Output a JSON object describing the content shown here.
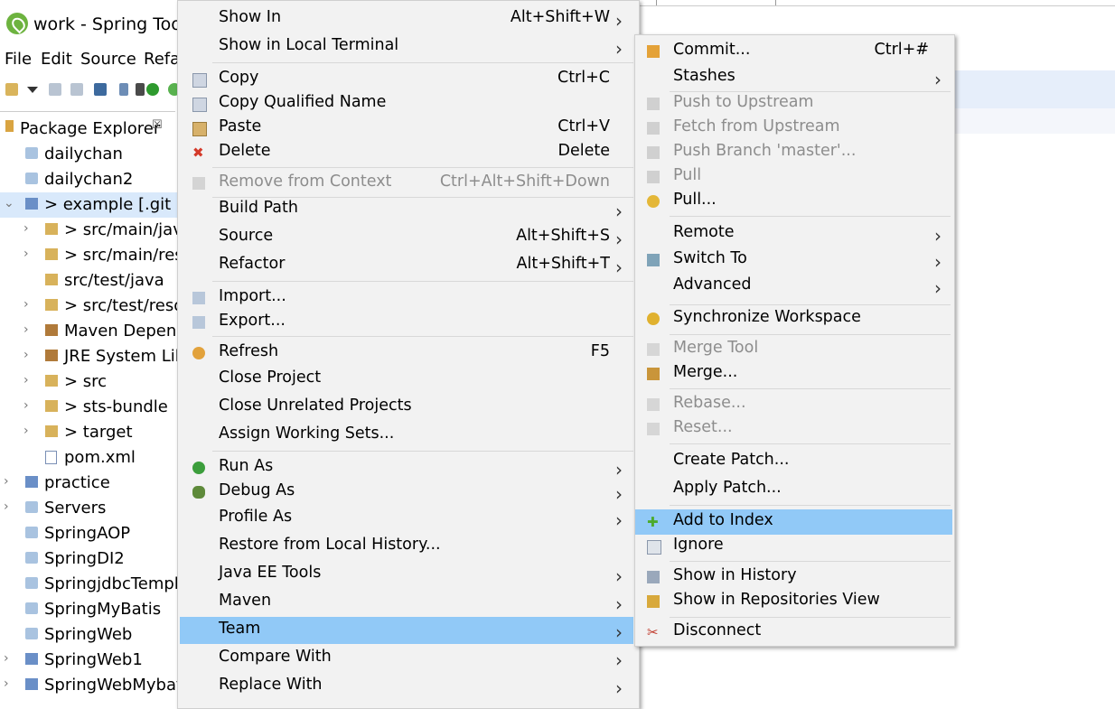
{
  "window": {
    "title": "work - Spring Tool"
  },
  "menubar": [
    "File",
    "Edit",
    "Source",
    "Refa"
  ],
  "explorer": {
    "tab_label": "Package Explorer",
    "close_glyph": "☒"
  },
  "tree": [
    {
      "label": "dailychan",
      "indent": 0,
      "twisty": "",
      "icon": "proj"
    },
    {
      "label": "dailychan2",
      "indent": 0,
      "twisty": "",
      "icon": "proj"
    },
    {
      "label": "> example [.git m",
      "indent": 0,
      "twisty": "v",
      "icon": "maven",
      "selected": true
    },
    {
      "label": "> src/main/java",
      "indent": 1,
      "twisty": ">",
      "icon": "pkg"
    },
    {
      "label": "> src/main/reso",
      "indent": 1,
      "twisty": ">",
      "icon": "pkg"
    },
    {
      "label": "src/test/java",
      "indent": 1,
      "twisty": "",
      "icon": "pkg"
    },
    {
      "label": "> src/test/reso",
      "indent": 1,
      "twisty": ">",
      "icon": "pkg"
    },
    {
      "label": "Maven Depend",
      "indent": 1,
      "twisty": ">",
      "icon": "lib"
    },
    {
      "label": "JRE System Libr",
      "indent": 1,
      "twisty": ">",
      "icon": "lib"
    },
    {
      "label": "> src",
      "indent": 1,
      "twisty": ">",
      "icon": "pkg"
    },
    {
      "label": "> sts-bundle",
      "indent": 1,
      "twisty": ">",
      "icon": "pkg"
    },
    {
      "label": "> target",
      "indent": 1,
      "twisty": ">",
      "icon": "pkg"
    },
    {
      "label": "pom.xml",
      "indent": 1,
      "twisty": "",
      "icon": "file"
    },
    {
      "label": "practice",
      "indent": 0,
      "twisty": ">",
      "icon": "maven"
    },
    {
      "label": "Servers",
      "indent": 0,
      "twisty": ">",
      "icon": "proj"
    },
    {
      "label": "SpringAOP",
      "indent": 0,
      "twisty": "",
      "icon": "proj"
    },
    {
      "label": "SpringDI2",
      "indent": 0,
      "twisty": "",
      "icon": "proj"
    },
    {
      "label": "SpringjdbcTempla",
      "indent": 0,
      "twisty": "",
      "icon": "proj"
    },
    {
      "label": "SpringMyBatis",
      "indent": 0,
      "twisty": "",
      "icon": "proj"
    },
    {
      "label": "SpringWeb",
      "indent": 0,
      "twisty": "",
      "icon": "proj"
    },
    {
      "label": "SpringWeb1",
      "indent": 0,
      "twisty": ">",
      "icon": "maven"
    },
    {
      "label": "SpringWebMybati",
      "indent": 0,
      "twisty": ">",
      "icon": "maven"
    }
  ],
  "context_menu": {
    "items": [
      {
        "label": "Show In",
        "accel": "Alt+Shift+W",
        "arrow": true
      },
      {
        "label": "Show in Local Terminal",
        "accel": "",
        "arrow": true
      },
      {
        "label": "Copy",
        "accel": "Ctrl+C",
        "icon": "copy-icon"
      },
      {
        "label": "Copy Qualified Name",
        "accel": "",
        "icon": "copy-qualified-icon"
      },
      {
        "label": "Paste",
        "accel": "Ctrl+V",
        "icon": "paste-icon"
      },
      {
        "label": "Delete",
        "accel": "Delete",
        "icon": "delete-icon"
      },
      {
        "label": "Remove from Context",
        "accel": "Ctrl+Alt+Shift+Down",
        "disabled": true,
        "icon": "remove-context-icon"
      },
      {
        "label": "Build Path",
        "accel": "",
        "arrow": true
      },
      {
        "label": "Source",
        "accel": "Alt+Shift+S",
        "arrow": true
      },
      {
        "label": "Refactor",
        "accel": "Alt+Shift+T",
        "arrow": true
      },
      {
        "label": "Import...",
        "accel": "",
        "icon": "import-icon"
      },
      {
        "label": "Export...",
        "accel": "",
        "icon": "export-icon"
      },
      {
        "label": "Refresh",
        "accel": "F5",
        "icon": "refresh-icon"
      },
      {
        "label": "Close Project",
        "accel": ""
      },
      {
        "label": "Close Unrelated Projects",
        "accel": ""
      },
      {
        "label": "Assign Working Sets...",
        "accel": ""
      },
      {
        "label": "Run As",
        "accel": "",
        "arrow": true,
        "icon": "run-icon"
      },
      {
        "label": "Debug As",
        "accel": "",
        "arrow": true,
        "icon": "debug-icon"
      },
      {
        "label": "Profile As",
        "accel": "",
        "arrow": true
      },
      {
        "label": "Restore from Local History...",
        "accel": ""
      },
      {
        "label": "Java EE Tools",
        "accel": "",
        "arrow": true
      },
      {
        "label": "Maven",
        "accel": "",
        "arrow": true
      },
      {
        "label": "Team",
        "accel": "",
        "arrow": true,
        "highlighted": true
      },
      {
        "label": "Compare With",
        "accel": "",
        "arrow": true
      },
      {
        "label": "Replace With",
        "accel": "",
        "arrow": true
      }
    ]
  },
  "team_menu": {
    "items": [
      {
        "label": "Commit...",
        "accel": "Ctrl+#",
        "icon": "commit-icon"
      },
      {
        "label": "Stashes",
        "accel": "",
        "arrow": true
      },
      {
        "label": "Push to Upstream",
        "disabled": true,
        "icon": "push-icon"
      },
      {
        "label": "Fetch from Upstream",
        "disabled": true,
        "icon": "fetch-icon"
      },
      {
        "label": "Push Branch 'master'...",
        "disabled": true,
        "icon": "push-branch-icon"
      },
      {
        "label": "Pull",
        "disabled": true,
        "icon": "pull-icon"
      },
      {
        "label": "Pull...",
        "icon": "pull-dialog-icon"
      },
      {
        "label": "Remote",
        "arrow": true
      },
      {
        "label": "Switch To",
        "arrow": true,
        "icon": "switch-branch-icon"
      },
      {
        "label": "Advanced",
        "arrow": true
      },
      {
        "label": "Synchronize Workspace",
        "icon": "synchronize-icon"
      },
      {
        "label": "Merge Tool",
        "disabled": true,
        "icon": "merge-tool-icon"
      },
      {
        "label": "Merge...",
        "icon": "merge-icon"
      },
      {
        "label": "Rebase...",
        "disabled": true,
        "icon": "rebase-icon"
      },
      {
        "label": "Reset...",
        "disabled": true,
        "icon": "reset-icon"
      },
      {
        "label": "Create Patch..."
      },
      {
        "label": "Apply Patch..."
      },
      {
        "label": "Add to Index",
        "highlighted": true,
        "icon": "add-icon"
      },
      {
        "label": "Ignore",
        "icon": "ignore-icon"
      },
      {
        "label": "Show in History",
        "icon": "history-icon"
      },
      {
        "label": "Show in Repositories View",
        "icon": "repositories-icon"
      },
      {
        "label": "Disconnect",
        "icon": "disconnect-icon"
      }
    ]
  },
  "colors": {
    "highlight": "#91c9f7",
    "menu_bg": "#f2f2f2",
    "disabled_text": "#8d8d8d",
    "selection": "#d9e9fb"
  }
}
